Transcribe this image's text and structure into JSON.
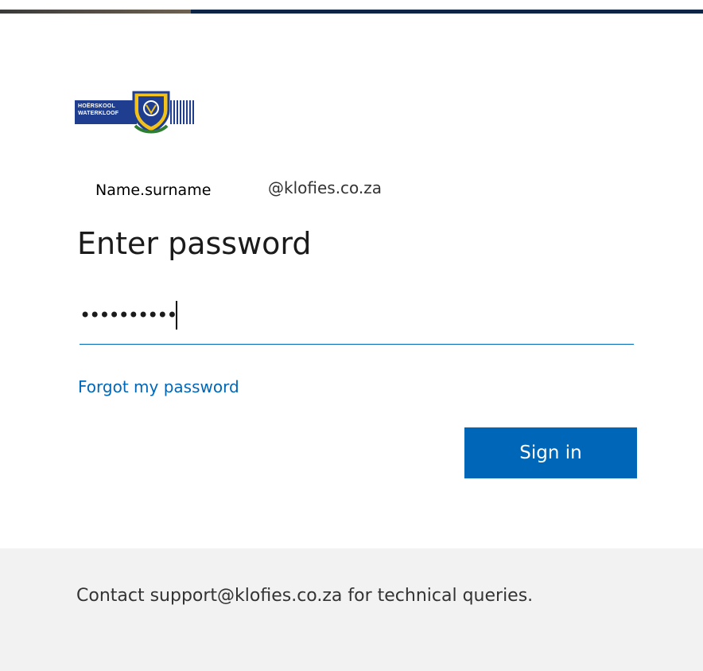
{
  "branding": {
    "logo_line1": "HOËRSKOOL",
    "logo_line2": "WATERKLOOF",
    "logo_colors": {
      "navy": "#1f3e8f",
      "shield_yellow": "#f2c21b",
      "shield_green": "#2e7d32"
    }
  },
  "account": {
    "name": "Name.surname",
    "domain": "@klofies.co.za"
  },
  "page": {
    "title": "Enter password"
  },
  "password": {
    "masked_value": "••••••••••"
  },
  "links": {
    "forgot": "Forgot my password"
  },
  "actions": {
    "sign_in": "Sign in"
  },
  "footer": {
    "text": "Contact support@klofies.co.za for technical queries."
  },
  "colors": {
    "accent": "#0067b8",
    "footer_bg": "#f2f2f2",
    "top_bar": "#0f2545"
  }
}
